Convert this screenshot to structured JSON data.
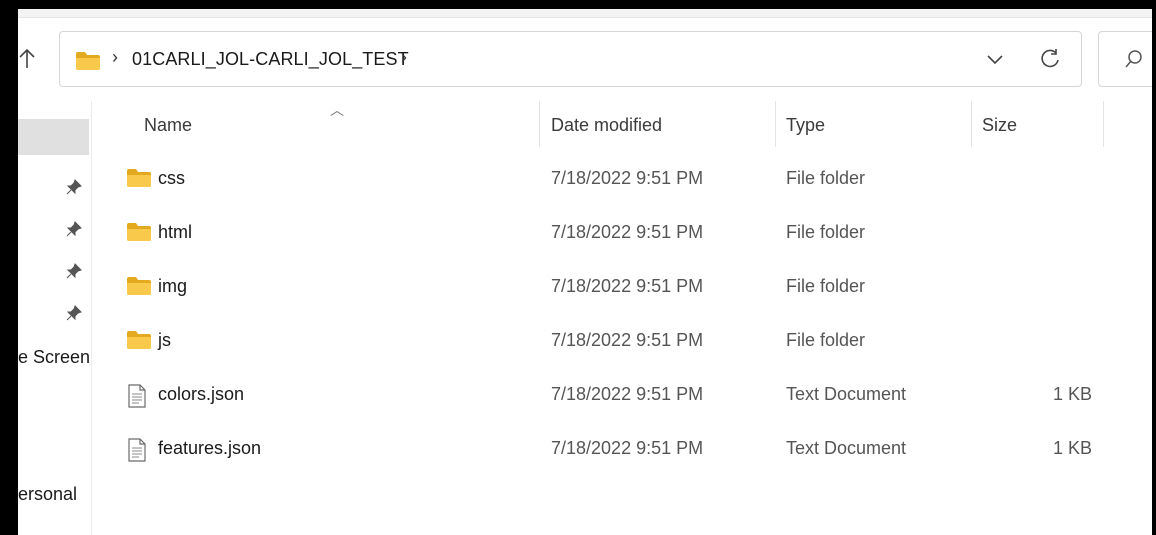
{
  "address": {
    "path": "01CARLI_JOL-CARLI_JOL_TEST"
  },
  "nav": {
    "labels": [
      "e Screen",
      "ersonal"
    ]
  },
  "columns": {
    "name": "Name",
    "date": "Date modified",
    "type": "Type",
    "size": "Size"
  },
  "files": [
    {
      "name": "css",
      "date": "7/18/2022 9:51 PM",
      "type": "File folder",
      "size": "",
      "kind": "folder"
    },
    {
      "name": "html",
      "date": "7/18/2022 9:51 PM",
      "type": "File folder",
      "size": "",
      "kind": "folder"
    },
    {
      "name": "img",
      "date": "7/18/2022 9:51 PM",
      "type": "File folder",
      "size": "",
      "kind": "folder"
    },
    {
      "name": "js",
      "date": "7/18/2022 9:51 PM",
      "type": "File folder",
      "size": "",
      "kind": "folder"
    },
    {
      "name": "colors.json",
      "date": "7/18/2022 9:51 PM",
      "type": "Text Document",
      "size": "1 KB",
      "kind": "text-document"
    },
    {
      "name": "features.json",
      "date": "7/18/2022 9:51 PM",
      "type": "Text Document",
      "size": "1 KB",
      "kind": "text-document"
    }
  ],
  "icons": {
    "up": "arrow-up-icon",
    "folder": "folder-icon",
    "chevron": "chevron-right-icon",
    "dropdown": "chevron-down-icon",
    "refresh": "refresh-icon",
    "search": "search-icon",
    "pin": "pin-icon",
    "document": "document-icon"
  },
  "colors": {
    "folder_yellow": "#f8c94a",
    "folder_dark": "#e3a91f",
    "selection_gray": "#e0e0e0"
  }
}
